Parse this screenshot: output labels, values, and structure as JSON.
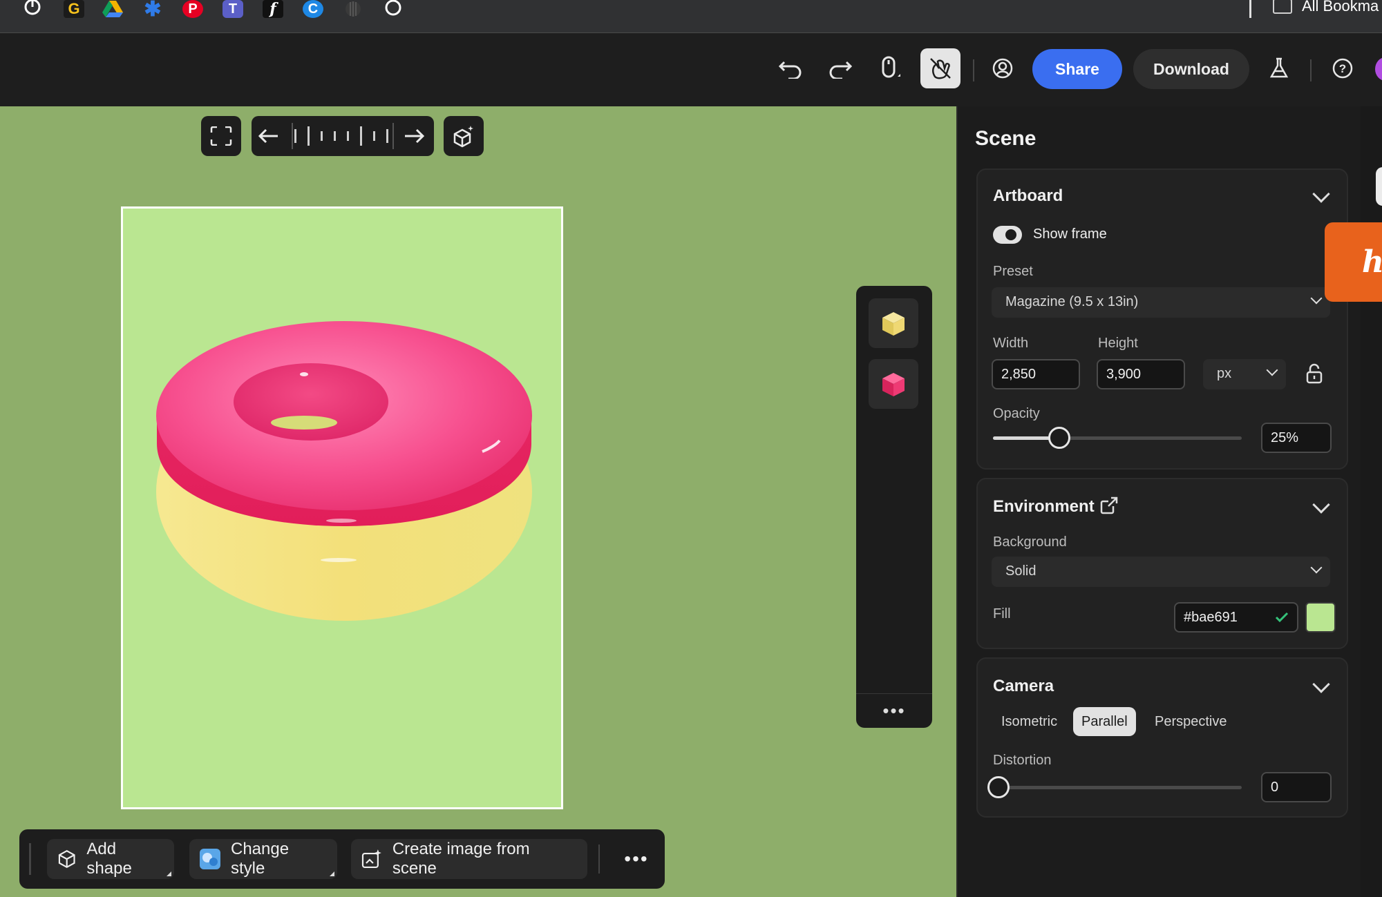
{
  "bookmarks": {
    "folder_label": "All Bookma",
    "icons": [
      "power-icon",
      "grammarly-icon",
      "google-drive-icon",
      "snowflake-icon",
      "pinterest-icon",
      "teams-icon",
      "function-icon",
      "app-c-icon",
      "striped-circle-icon",
      "circle-icon"
    ],
    "grammarly_glyph": "G",
    "pinterest_glyph": "P",
    "teams_glyph": "T",
    "function_glyph": "f",
    "c_glyph": "C"
  },
  "header": {
    "share_label": "Share",
    "download_label": "Download",
    "undo_glyph": "⤺",
    "redo_glyph": "⤻",
    "help_glyph": "?",
    "flask_glyph": "⚗"
  },
  "canvas": {
    "background": "#8eae6a",
    "artboard_fill": "#bae691"
  },
  "bottom_bar": {
    "add_shape": "Add shape",
    "change_style": "Change style",
    "create_image": "Create image from scene",
    "more": "•••"
  },
  "side_panel": {
    "more": "•••"
  },
  "panel": {
    "title": "Scene",
    "artboard": {
      "title": "Artboard",
      "show_frame_label": "Show frame",
      "show_frame_on": true,
      "preset_label": "Preset",
      "preset_value": "Magazine (9.5 x 13in)",
      "width_label": "Width",
      "width_value": "2,850",
      "height_label": "Height",
      "height_value": "3,900",
      "unit_value": "px",
      "opacity_label": "Opacity",
      "opacity_value": "25%",
      "opacity_fraction": 0.25
    },
    "environment": {
      "title": "Environment",
      "background_label": "Background",
      "background_value": "Solid",
      "fill_label": "Fill",
      "fill_value": "#bae691",
      "fill_color": "#bae691"
    },
    "camera": {
      "title": "Camera",
      "options": [
        "Isometric",
        "Parallel",
        "Perspective"
      ],
      "selected": "Parallel",
      "distortion_label": "Distortion",
      "distortion_value": "0"
    }
  },
  "badge": {
    "glyph": "h"
  }
}
